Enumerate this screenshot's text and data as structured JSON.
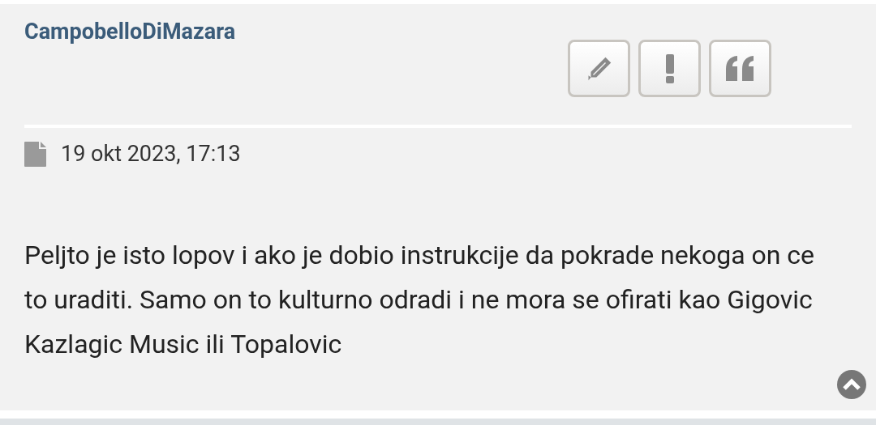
{
  "post": {
    "author": "CampobelloDiMazara",
    "actions": [
      {
        "kind": "edit"
      },
      {
        "kind": "report"
      },
      {
        "kind": "quote"
      }
    ],
    "date": "19 okt 2023, 17:13",
    "body": "Peljto je isto lopov i ako je dobio instrukcije da pokrade nekoga on ce to uraditi. Samo on to kulturno odradi i ne mora se ofirati kao Gigovic Kazlagic Music ili Topalovic"
  }
}
